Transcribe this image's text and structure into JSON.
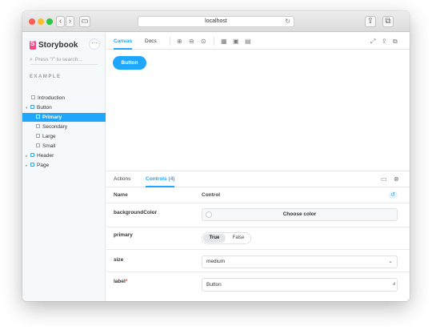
{
  "browser": {
    "url": "localhost",
    "icons": {
      "back": "chevron-left-icon",
      "forward": "chevron-right-icon",
      "sidebar": "sidebar-toggle-icon",
      "reload": "reload-icon",
      "share": "share-icon",
      "tabs": "tabs-icon"
    }
  },
  "sidebar": {
    "brand": "Storybook",
    "more_label": "···",
    "search_placeholder": "Press \"/\" to search...",
    "section_label": "EXAMPLE",
    "items": [
      {
        "label": "Introduction",
        "icon": "doc-icon"
      },
      {
        "label": "Button",
        "icon": "component-icon"
      },
      {
        "label": "Primary",
        "icon": "story-icon",
        "selected": true
      },
      {
        "label": "Secondary",
        "icon": "story-icon"
      },
      {
        "label": "Large",
        "icon": "story-icon"
      },
      {
        "label": "Small",
        "icon": "story-icon"
      },
      {
        "label": "Header",
        "icon": "component-icon"
      },
      {
        "label": "Page",
        "icon": "component-icon"
      }
    ]
  },
  "toolbar": {
    "tabs": [
      "Canvas",
      "Docs"
    ],
    "tools": [
      "zoom-in-icon",
      "zoom-out-icon",
      "zoom-reset-icon",
      "grid-icon",
      "background-icon",
      "measure-icon",
      "fullscreen-icon",
      "share-icon",
      "copy-icon"
    ]
  },
  "canvas": {
    "button_label": "Button",
    "accent": "#1ea7fd"
  },
  "panel": {
    "tabs": [
      "Actions",
      "Controls (4)"
    ],
    "header": {
      "name": "Name",
      "control": "Control"
    },
    "controls": [
      {
        "name": "backgroundColor",
        "value": "Choose color"
      },
      {
        "name": "primary",
        "true_label": "True",
        "false_label": "False",
        "value": "True"
      },
      {
        "name": "size",
        "value": "medium"
      },
      {
        "name": "label",
        "required": "*",
        "value": "Button"
      }
    ]
  }
}
